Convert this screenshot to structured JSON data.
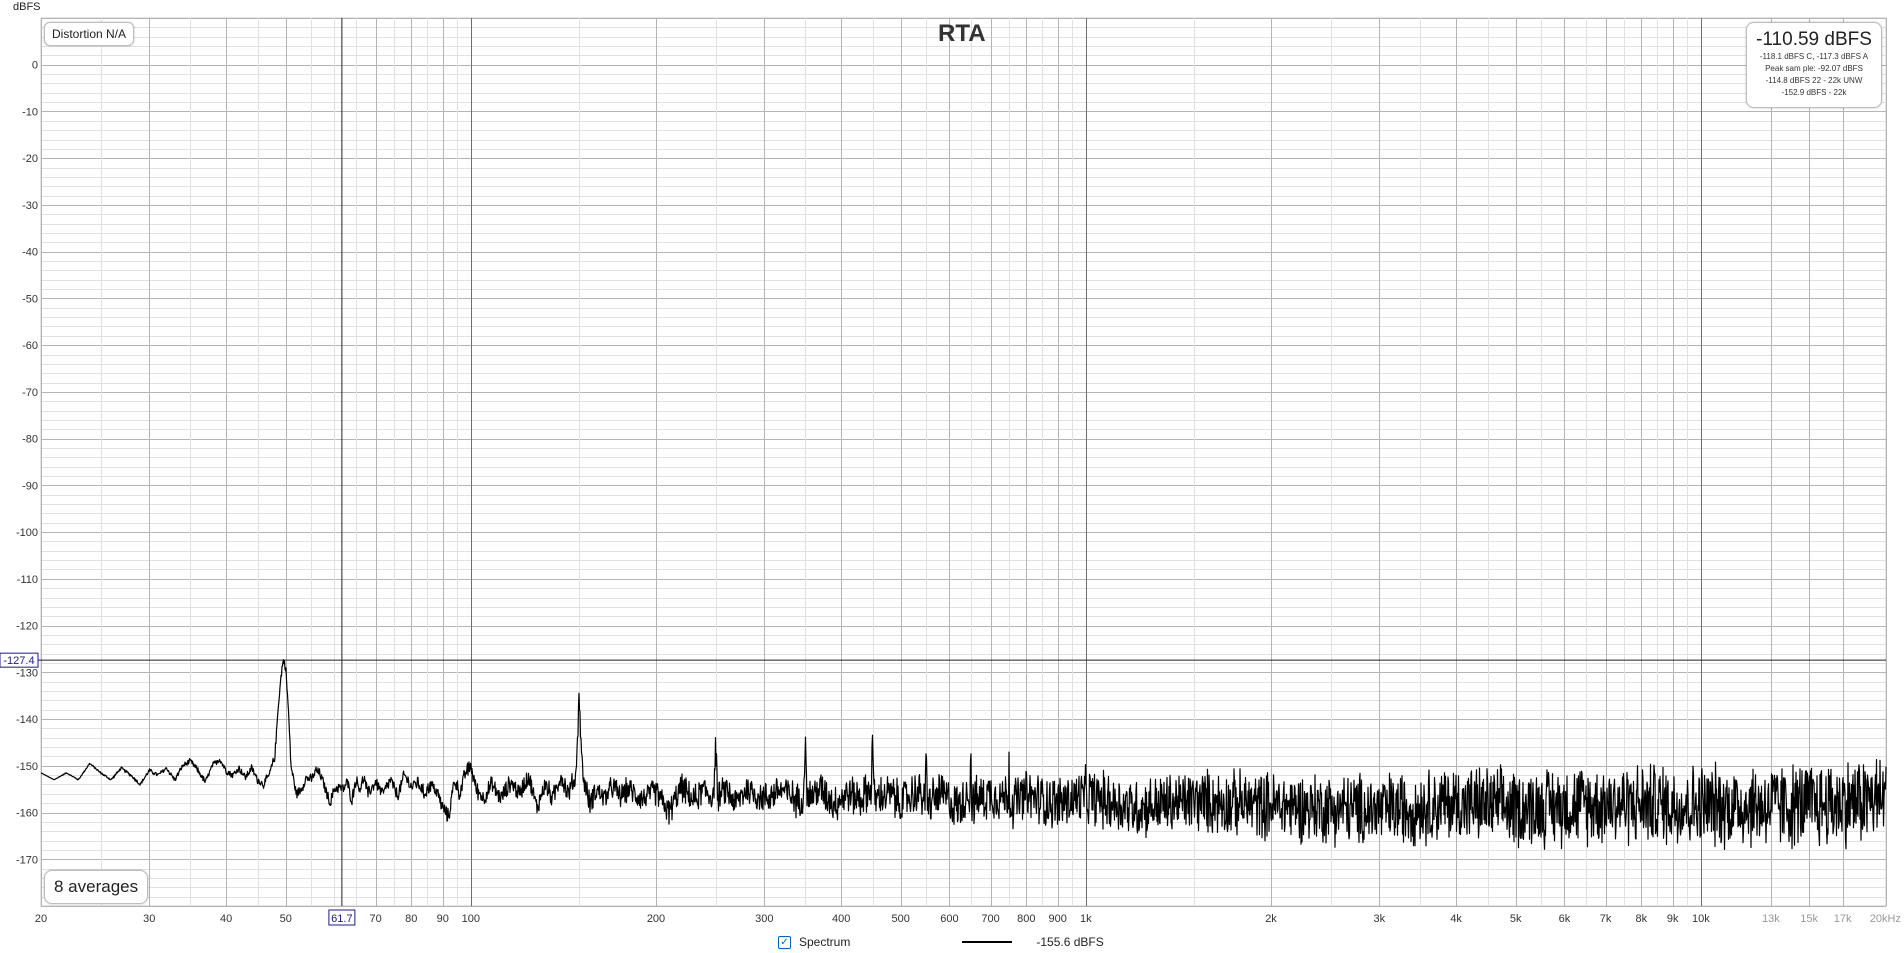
{
  "chart_data": {
    "type": "line",
    "title": "RTA",
    "ylabel": "dBFS",
    "xlabel": "",
    "x_scale": "log",
    "xlim": [
      20,
      20000
    ],
    "ylim": [
      -180,
      10
    ],
    "grid": true,
    "y_ticks": [
      0,
      -10,
      -20,
      -30,
      -40,
      -50,
      -60,
      -70,
      -80,
      -90,
      -100,
      -110,
      -120,
      -130,
      -140,
      -150,
      -160,
      -170
    ],
    "y_tick_labels": [
      "0",
      "-10",
      "-20",
      "-30",
      "-40",
      "-50",
      "-60",
      "-70",
      "-80",
      "-90",
      "-100",
      "-110",
      "-120",
      "-130",
      "-140",
      "-150",
      "-160",
      "-170"
    ],
    "x_ticks": [
      20,
      30,
      40,
      50,
      70,
      80,
      90,
      100,
      200,
      300,
      400,
      500,
      600,
      700,
      800,
      900,
      1000,
      2000,
      3000,
      4000,
      5000,
      6000,
      7000,
      8000,
      9000,
      10000,
      13000,
      15000,
      17000,
      20000
    ],
    "x_tick_labels": [
      "20",
      "30",
      "40",
      "50",
      "70",
      "80",
      "90",
      "100",
      "200",
      "300",
      "400",
      "500",
      "600",
      "700",
      "800",
      "900",
      "1k",
      "2k",
      "3k",
      "4k",
      "5k",
      "6k",
      "7k",
      "8k",
      "9k",
      "10k",
      "13k",
      "15k",
      "17k",
      "20kHz"
    ],
    "minor_x_ticks": [
      11000,
      12000,
      14000,
      16000,
      18000,
      19000
    ],
    "series": [
      {
        "name": "Spectrum",
        "color": "#000000",
        "points": [
          [
            20,
            -151.5
          ],
          [
            21,
            -153
          ],
          [
            22,
            -151.5
          ],
          [
            23,
            -153
          ],
          [
            24,
            -149.5
          ],
          [
            25,
            -151.5
          ],
          [
            26,
            -153
          ],
          [
            27,
            -150.5
          ],
          [
            28,
            -152
          ],
          [
            29,
            -154
          ],
          [
            30,
            -151
          ],
          [
            31,
            -152
          ],
          [
            32,
            -150.5
          ],
          [
            33,
            -153
          ],
          [
            34,
            -150
          ],
          [
            35,
            -149
          ],
          [
            36,
            -151
          ],
          [
            37,
            -153.5
          ],
          [
            38,
            -150
          ],
          [
            39,
            -148.5
          ],
          [
            40,
            -151
          ],
          [
            41,
            -152
          ],
          [
            42,
            -150.5
          ],
          [
            43,
            -152.5
          ],
          [
            44,
            -150.5
          ],
          [
            45,
            -153
          ],
          [
            46,
            -154
          ],
          [
            47,
            -152
          ],
          [
            48,
            -148
          ],
          [
            48.7,
            -136
          ],
          [
            49.3,
            -129
          ],
          [
            49.6,
            -127.4
          ],
          [
            50,
            -129
          ],
          [
            50.5,
            -138
          ],
          [
            51,
            -150
          ],
          [
            52,
            -156
          ],
          [
            53,
            -155
          ],
          [
            54,
            -152.5
          ],
          [
            55,
            -153
          ],
          [
            56,
            -151
          ],
          [
            57,
            -152
          ],
          [
            58,
            -155
          ],
          [
            59,
            -158
          ],
          [
            60,
            -155
          ],
          [
            61,
            -154.5
          ],
          [
            62,
            -155
          ],
          [
            63,
            -153.5
          ],
          [
            64,
            -157.5
          ],
          [
            65,
            -153
          ],
          [
            66,
            -155
          ],
          [
            67,
            -152.5
          ],
          [
            68,
            -156
          ],
          [
            70,
            -153.5
          ],
          [
            72,
            -156
          ],
          [
            74,
            -153
          ],
          [
            76,
            -156.5
          ],
          [
            78,
            -152
          ],
          [
            80,
            -154.5
          ],
          [
            82,
            -153.5
          ],
          [
            84,
            -156
          ],
          [
            86,
            -154
          ],
          [
            88,
            -155.5
          ],
          [
            90,
            -159
          ],
          [
            92,
            -161
          ],
          [
            94,
            -153
          ],
          [
            96,
            -156
          ],
          [
            98,
            -151.5
          ],
          [
            100,
            -150
          ],
          [
            102,
            -155
          ],
          [
            105,
            -157
          ],
          [
            108,
            -154
          ],
          [
            112,
            -157
          ],
          [
            116,
            -153.5
          ],
          [
            120,
            -156
          ],
          [
            124,
            -152
          ],
          [
            128,
            -159
          ],
          [
            132,
            -154
          ],
          [
            136,
            -157
          ],
          [
            140,
            -152
          ],
          [
            144,
            -156
          ],
          [
            146,
            -154
          ],
          [
            148,
            -153
          ],
          [
            149.5,
            -140
          ],
          [
            150,
            -134.5
          ],
          [
            150.5,
            -140
          ],
          [
            152,
            -152
          ],
          [
            156,
            -158
          ],
          [
            160,
            -155
          ],
          [
            165,
            -157
          ],
          [
            170,
            -154.5
          ],
          [
            175,
            -156.5
          ],
          [
            180,
            -155
          ],
          [
            190,
            -157
          ],
          [
            200,
            -155.5
          ],
          [
            210,
            -160
          ],
          [
            220,
            -154.5
          ],
          [
            230,
            -157.5
          ],
          [
            240,
            -155
          ],
          [
            248,
            -157
          ],
          [
            250,
            -145
          ],
          [
            252,
            -157
          ],
          [
            260,
            -155
          ],
          [
            270,
            -158
          ],
          [
            280,
            -155
          ],
          [
            300,
            -157
          ],
          [
            320,
            -155
          ],
          [
            340,
            -157.5
          ],
          [
            348,
            -156
          ],
          [
            350,
            -141
          ],
          [
            352,
            -157
          ],
          [
            370,
            -155
          ],
          [
            390,
            -158
          ],
          [
            410,
            -156
          ],
          [
            430,
            -157
          ],
          [
            448,
            -155
          ],
          [
            450,
            -141
          ],
          [
            452,
            -157
          ],
          [
            480,
            -156
          ],
          [
            500,
            -158
          ],
          [
            530,
            -155.5
          ],
          [
            548,
            -157
          ],
          [
            550,
            -147
          ],
          [
            552,
            -158
          ],
          [
            580,
            -156
          ],
          [
            620,
            -159
          ],
          [
            648,
            -155
          ],
          [
            650,
            -146
          ],
          [
            652,
            -158
          ],
          [
            700,
            -156
          ],
          [
            748,
            -157
          ],
          [
            750,
            -148
          ],
          [
            752,
            -158
          ],
          [
            800,
            -156.5
          ],
          [
            900,
            -158
          ],
          [
            1000,
            -156.5
          ],
          [
            1200,
            -159
          ],
          [
            1500,
            -157.5
          ],
          [
            2000,
            -158.5
          ],
          [
            3000,
            -159.5
          ],
          [
            4000,
            -158
          ],
          [
            5000,
            -159
          ],
          [
            7000,
            -158
          ],
          [
            10000,
            -158.5
          ],
          [
            15000,
            -158.5
          ],
          [
            20000,
            -157
          ]
        ],
        "noise_band_db": [
          [
            20,
            0
          ],
          [
            100,
            2
          ],
          [
            300,
            4
          ],
          [
            700,
            6
          ],
          [
            1000,
            7
          ],
          [
            3000,
            9
          ],
          [
            20000,
            11
          ]
        ]
      }
    ],
    "cursor": {
      "x": 61.7,
      "x_label": "61.7",
      "y": -127.4,
      "y_label": "-127.4"
    }
  },
  "overlays": {
    "distortion_label": "Distortion N/A",
    "averages_label": "8 averages",
    "level_main": "-110.59 dBFS",
    "level_lines": [
      "-118.1 dBFS C, -117.3 dBFS A",
      "Peak sam ple: -92.07 dBFS",
      "-114.8 dBFS 22 - 22k UNW",
      "-152.9 dBFS - 22k"
    ]
  },
  "legend": {
    "checked": true,
    "series_label": "Spectrum",
    "value_label": "-155.6 dBFS"
  },
  "colors": {
    "trace": "#000000",
    "major_grid": "#b4b4b4",
    "minor_grid": "#e1e1e1",
    "decade_line": "#6e6e6e",
    "cursor_box": "#1a1a8c"
  }
}
